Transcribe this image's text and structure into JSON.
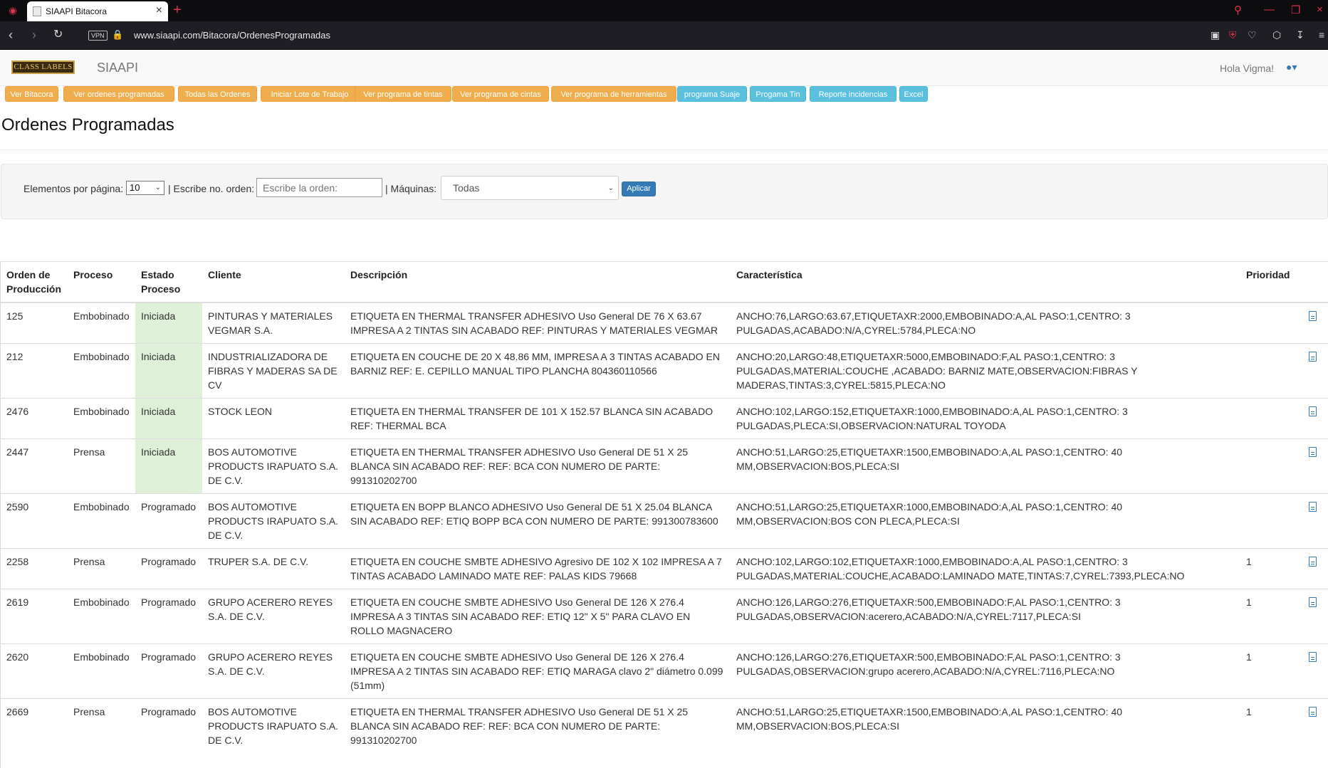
{
  "browser": {
    "tab_title": "SIAAPI Bitacora",
    "url": "www.siaapi.com/Bitacora/OrdenesProgramadas",
    "vpn_label": "VPN"
  },
  "navbar": {
    "logo_text": "CLASS LABELS",
    "brand": "SIAAPI",
    "greeting": "Hola Vigma!"
  },
  "actions": [
    {
      "label": "Ver Bitacora",
      "style": "warning"
    },
    {
      "label": "Ver ordenes programadas",
      "style": "warning"
    },
    {
      "label": "Todas las Ordenes",
      "style": "warning"
    },
    {
      "label": "Iniciar Lote de Trabajo",
      "style": "warning"
    },
    {
      "label": "Ver programa de tintas",
      "style": "warning"
    },
    {
      "label": "Ver programa de cintas",
      "style": "warning"
    },
    {
      "label": "Ver programa de herramientas",
      "style": "warning"
    },
    {
      "label": "programa Suaje",
      "style": "info"
    },
    {
      "label": "Progama Tin",
      "style": "info"
    },
    {
      "label": "Reporte incidencias",
      "style": "info"
    },
    {
      "label": "Excel",
      "style": "info"
    }
  ],
  "page_title": "Ordenes Programadas",
  "filters": {
    "per_page_label": "Elementos por página:",
    "per_page_value": "10",
    "order_label": "| Escribe no. orden:",
    "order_placeholder": "Escribe la orden:",
    "machines_label": "| Máquinas:",
    "machines_value": "Todas",
    "apply_label": "Aplicar"
  },
  "table": {
    "headers": [
      "Orden de Producción",
      "Proceso",
      "Estado Proceso",
      "Cliente",
      "Descripción",
      "Característica",
      "Prioridad"
    ],
    "rows": [
      {
        "orden": "125",
        "proceso": "Embobinado",
        "estado": "Iniciada",
        "cliente": "PINTURAS Y MATERIALES VEGMAR S.A.",
        "descripcion": "ETIQUETA EN THERMAL TRANSFER ADHESIVO Uso General DE 76 X 63.67 IMPRESA A 2 TINTAS SIN ACABADO REF: PINTURAS Y MATERIALES VEGMAR",
        "caracteristica": "ANCHO:76,LARGO:63.67,ETIQUETAXR:2000,EMBOBINADO:A,AL PASO:1,CENTRO: 3 PULGADAS,ACABADO:N/A,CYREL:5784,PLECA:NO",
        "prioridad": ""
      },
      {
        "orden": "212",
        "proceso": "Embobinado",
        "estado": "Iniciada",
        "cliente": "INDUSTRIALIZADORA DE FIBRAS Y MADERAS SA DE CV",
        "descripcion": "ETIQUETA EN COUCHE DE 20 X 48.86 MM, IMPRESA A 3 TINTAS ACABADO EN BARNIZ REF: E. CEPILLO MANUAL TIPO PLANCHA 804360110566",
        "caracteristica": "ANCHO:20,LARGO:48,ETIQUETAXR:5000,EMBOBINADO:F,AL PASO:1,CENTRO: 3 PULGADAS,MATERIAL:COUCHE ,ACABADO: BARNIZ MATE,OBSERVACION:FIBRAS Y MADERAS,TINTAS:3,CYREL:5815,PLECA:NO",
        "prioridad": ""
      },
      {
        "orden": "2476",
        "proceso": "Embobinado",
        "estado": "Iniciada",
        "cliente": "STOCK LEON",
        "descripcion": "ETIQUETA EN THERMAL TRANSFER DE 101 X 152.57 BLANCA SIN ACABADO REF: THERMAL BCA",
        "caracteristica": "ANCHO:102,LARGO:152,ETIQUETAXR:1000,EMBOBINADO:A,AL PASO:1,CENTRO: 3 PULGADAS,PLECA:SI,OBSERVACION:NATURAL TOYODA",
        "prioridad": ""
      },
      {
        "orden": "2447",
        "proceso": "Prensa",
        "estado": "Iniciada",
        "cliente": "BOS AUTOMOTIVE PRODUCTS IRAPUATO S.A. DE C.V.",
        "descripcion": "ETIQUETA EN THERMAL TRANSFER ADHESIVO Uso General DE 51 X 25 BLANCA SIN ACABADO REF: REF: BCA CON NUMERO DE PARTE: 991310202700",
        "caracteristica": "ANCHO:51,LARGO:25,ETIQUETAXR:1500,EMBOBINADO:A,AL PASO:1,CENTRO: 40 MM,OBSERVACION:BOS,PLECA:SI",
        "prioridad": ""
      },
      {
        "orden": "2590",
        "proceso": "Embobinado",
        "estado": "Programado",
        "cliente": "BOS AUTOMOTIVE PRODUCTS IRAPUATO S.A. DE C.V.",
        "descripcion": "ETIQUETA EN BOPP BLANCO ADHESIVO Uso General DE 51 X 25.04 BLANCA SIN ACABADO REF: ETIQ BOPP BCA CON NUMERO DE PARTE: 991300783600",
        "caracteristica": "ANCHO:51,LARGO:25,ETIQUETAXR:1000,EMBOBINADO:A,AL PASO:1,CENTRO: 40 MM,OBSERVACION:BOS CON PLECA,PLECA:SI",
        "prioridad": ""
      },
      {
        "orden": "2258",
        "proceso": "Prensa",
        "estado": "Programado",
        "cliente": "TRUPER S.A. DE C.V.",
        "descripcion": "ETIQUETA EN COUCHE SMBTE ADHESIVO Agresivo DE 102 X 102 IMPRESA A 7 TINTAS ACABADO LAMINADO MATE REF: PALAS KIDS 79668",
        "caracteristica": "ANCHO:102,LARGO:102,ETIQUETAXR:1000,EMBOBINADO:A,AL PASO:1,CENTRO: 3 PULGADAS,MATERIAL:COUCHE,ACABADO:LAMINADO MATE,TINTAS:7,CYREL:7393,PLECA:NO",
        "prioridad": "1"
      },
      {
        "orden": "2619",
        "proceso": "Embobinado",
        "estado": "Programado",
        "cliente": "GRUPO ACERERO REYES S.A. DE C.V.",
        "descripcion": "ETIQUETA EN COUCHE SMBTE ADHESIVO Uso General DE 126 X 276.4 IMPRESA A 3 TINTAS SIN ACABADO REF: ETIQ 12\" X 5\" PARA CLAVO EN ROLLO MAGNACERO",
        "caracteristica": "ANCHO:126,LARGO:276,ETIQUETAXR:500,EMBOBINADO:F,AL PASO:1,CENTRO: 3 PULGADAS,OBSERVACION:acerero,ACABADO:N/A,CYREL:7117,PLECA:SI",
        "prioridad": "1"
      },
      {
        "orden": "2620",
        "proceso": "Embobinado",
        "estado": "Programado",
        "cliente": "GRUPO ACERERO REYES S.A. DE C.V.",
        "descripcion": "ETIQUETA EN COUCHE SMBTE ADHESIVO Uso General DE 126 X 276.4 IMPRESA A 2 TINTAS SIN ACABADO REF: ETIQ MARAGA clavo 2\" diámetro 0.099 (51mm)",
        "caracteristica": "ANCHO:126,LARGO:276,ETIQUETAXR:500,EMBOBINADO:F,AL PASO:1,CENTRO: 3 PULGADAS,OBSERVACION:grupo acerero,ACABADO:N/A,CYREL:7116,PLECA:NO",
        "prioridad": "1"
      },
      {
        "orden": "2669",
        "proceso": "Prensa",
        "estado": "Programado",
        "cliente": "BOS AUTOMOTIVE PRODUCTS IRAPUATO S.A. DE C.V.",
        "descripcion": "ETIQUETA EN THERMAL TRANSFER ADHESIVO Uso General DE 51 X 25 BLANCA SIN ACABADO REF: REF: BCA CON NUMERO DE PARTE: 991310202700",
        "caracteristica": "ANCHO:51,LARGO:25,ETIQUETAXR:1500,EMBOBINADO:A,AL PASO:1,CENTRO: 40 MM,OBSERVACION:BOS,PLECA:SI",
        "prioridad": "1"
      }
    ]
  }
}
